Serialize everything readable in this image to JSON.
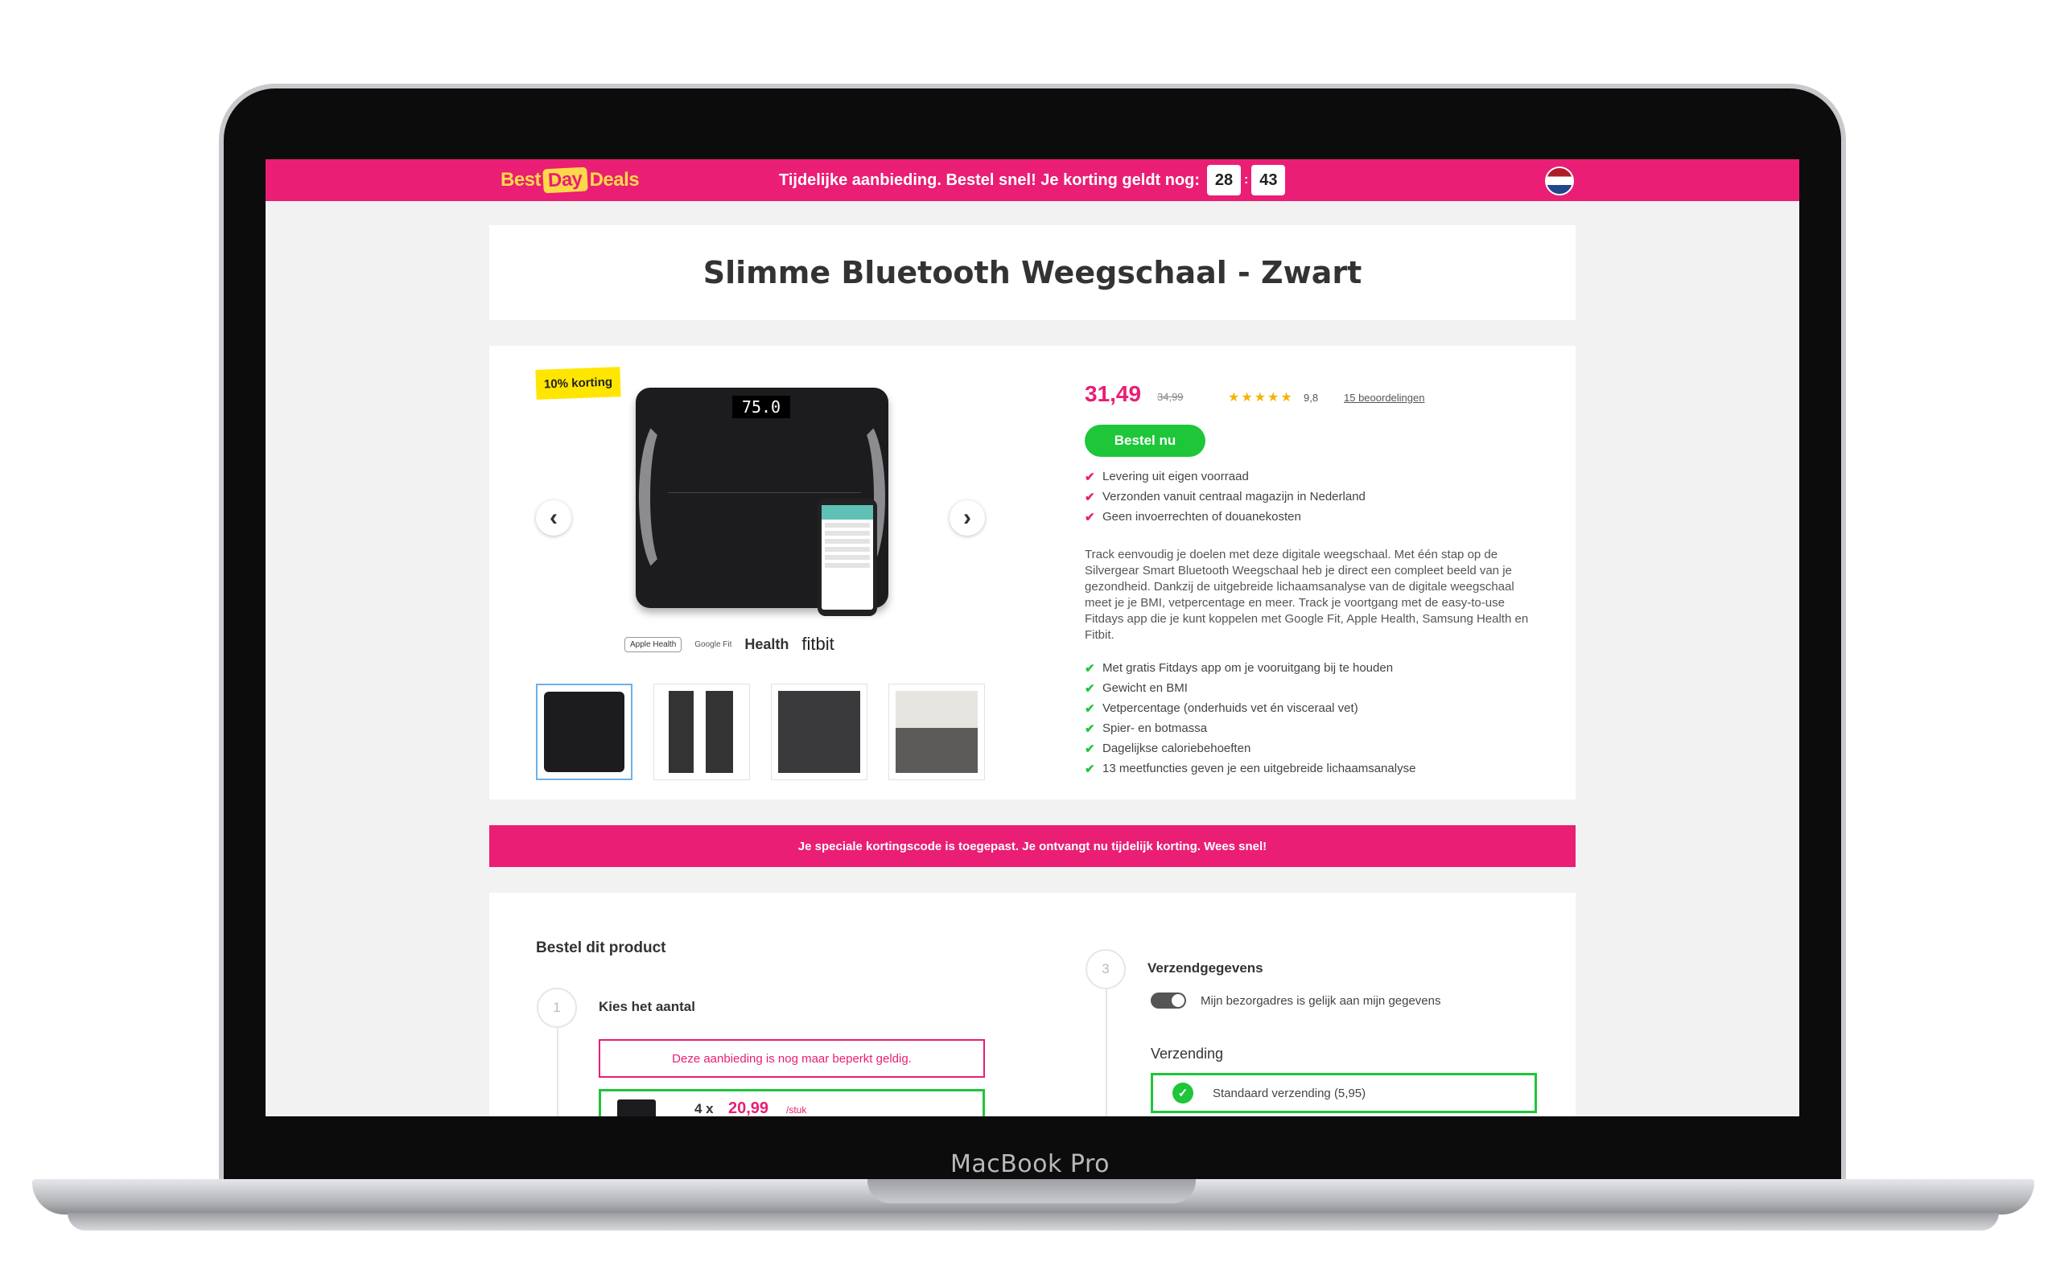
{
  "device": {
    "label": "MacBook Pro"
  },
  "topbar": {
    "logo": {
      "part1": "Best",
      "part2": "Day",
      "part3": "Deals"
    },
    "promo_text": "Tijdelijke aanbieding. Bestel snel! Je korting geldt nog:",
    "timer": {
      "minutes": "28",
      "seconds": "43",
      "separator": ":"
    },
    "flag_icon": "netherlands-flag-icon"
  },
  "product": {
    "title": "Slimme Bluetooth Weegschaal - Zwart",
    "badge": "10% korting",
    "scale_display": "75.0",
    "partners": [
      "Apple Health",
      "Google Fit",
      "Health",
      "fitbit"
    ],
    "price": "31,49",
    "old_price": "34,99",
    "stars": "★★★★★",
    "rating": "9,8",
    "reviews": "15 beoordelingen",
    "order_button": "Bestel nu",
    "usps": [
      "Levering uit eigen voorraad",
      "Verzonden vanuit centraal magazijn in Nederland",
      "Geen invoerrechten of douanekosten"
    ],
    "description": "Track eenvoudig je doelen met deze digitale weegschaal. Met één stap op de Silvergear Smart Bluetooth Weegschaal heb je direct een compleet beeld van je gezondheid. Dankzij de uitgebreide lichaamsanalyse van de digitale weegschaal meet je je BMI, vetpercentage en meer. Track je voortgang met de easy-to-use Fitdays app die je kunt koppelen met Google Fit, Apple Health, Samsung Health en Fitbit.",
    "features": [
      "Met gratis Fitdays app om je vooruitgang bij te houden",
      "Gewicht en BMI",
      "Vetpercentage (onderhuids vet én visceraal vet)",
      "Spier- en botmassa",
      "Dagelijkse caloriebehoeften",
      "13 meetfuncties geven je een uitgebreide lichaamsanalyse"
    ]
  },
  "notice": "Je speciale kortingscode is toegepast. Je ontvangt nu tijdelijk korting. Wees snel!",
  "order": {
    "heading": "Bestel dit product",
    "step1": {
      "number": "1",
      "label": "Kies het aantal"
    },
    "limited_text": "Deze aanbieding is nog maar beperkt geldig.",
    "qty_option": {
      "qty": "4 x",
      "price": "20,99",
      "unit": "/stuk"
    },
    "step3": {
      "number": "3",
      "label": "Verzendgegevens"
    },
    "toggle_label": "Mijn bezorgadres is gelijk aan mijn gegevens",
    "shipping_title": "Verzending",
    "shipping_option": "Standaard verzending (5,95)"
  },
  "colors": {
    "brand": "#e91e74",
    "accent": "#1ec63a",
    "badge": "#ffe600",
    "logo": "#ffd84a"
  }
}
